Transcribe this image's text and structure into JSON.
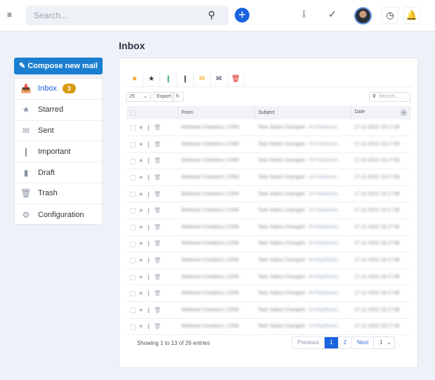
{
  "topbar": {
    "search_placeholder": "Search...",
    "icons": [
      "menu-icon",
      "search-icon",
      "plus-icon",
      "share-icon",
      "check-icon",
      "avatar",
      "clock-icon",
      "bell-icon"
    ]
  },
  "page_title": "Inbox",
  "sidebar": {
    "compose_label": "Compose new mail",
    "items": [
      {
        "label": "Inbox",
        "icon": "inbox-icon",
        "badge": "3",
        "active": true
      },
      {
        "label": "Starred",
        "icon": "star-icon"
      },
      {
        "label": "Sent",
        "icon": "envelope-icon"
      },
      {
        "label": "Important",
        "icon": "bookmark-icon"
      },
      {
        "label": "Draft",
        "icon": "draft-icon"
      },
      {
        "label": "Trash",
        "icon": "trash-icon"
      },
      {
        "label": "Configuration",
        "icon": "gears-icon"
      }
    ]
  },
  "toolbar": {
    "filters": [
      {
        "icon": "star-icon",
        "color": "#f59e0b"
      },
      {
        "icon": "star-icon",
        "color": "#2b3546"
      },
      {
        "icon": "bookmark-icon",
        "color": "#22a04b"
      },
      {
        "icon": "bookmark-icon",
        "color": "#2b3546"
      },
      {
        "icon": "envelope-icon",
        "color": "#f59e0b"
      },
      {
        "icon": "envelope-icon",
        "color": "#2b3546"
      },
      {
        "icon": "trash-icon",
        "color": "#e11d1d"
      }
    ],
    "page_length": "25",
    "export_label": "Export",
    "search_placeholder": "Search..."
  },
  "table": {
    "headers": [
      "From",
      "Subject",
      "Date"
    ],
    "rows": [
      {
        "from": "Webwise Creations | CRM",
        "subject": "Task Status Changed",
        "preview": "- Hi PaulGrant...",
        "date": "17-11-2022 18:17:08"
      },
      {
        "from": "Webwise Creations | CRM",
        "subject": "Task Status Changed",
        "preview": "- Hi PaulGrant...",
        "date": "17-11-2022 18:17:08"
      },
      {
        "from": "Webwise Creations | CRM",
        "subject": "Task Status Changed",
        "preview": "- Hi PaulGrant...",
        "date": "17-11-2022 18:17:08"
      },
      {
        "from": "Webwise Creations | CRM",
        "subject": "Task Status Changed",
        "preview": "- Hi PaulGrant...",
        "date": "17-11-2022 18:17:08"
      },
      {
        "from": "Webwise Creations | CRM",
        "subject": "Task Status Changed",
        "preview": "- Hi PaulGrant...",
        "date": "17-11-2022 18:17:08"
      },
      {
        "from": "Webwise Creations | CRM",
        "subject": "Task Status Changed",
        "preview": "- Hi PaulGrant...",
        "date": "17-11-2022 18:17:08"
      },
      {
        "from": "Webwise Creations | CRM",
        "subject": "Task Status Changed",
        "preview": "- Hi PaulGrant...",
        "date": "17-11-2022 18:17:08"
      },
      {
        "from": "Webwise Creations | CRM",
        "subject": "Task Status Changed",
        "preview": "- Hi PaulGrant...",
        "date": "17-11-2022 18:17:08"
      },
      {
        "from": "Webwise Creations | CRM",
        "subject": "Task Status Changed",
        "preview": "- Hi PaulGrant...",
        "date": "17-11-2022 18:17:08"
      },
      {
        "from": "Webwise Creations | CRM",
        "subject": "Task Status Changed",
        "preview": "- Hi PaulGrant...",
        "date": "17-11-2022 18:17:08"
      },
      {
        "from": "Webwise Creations | CRM",
        "subject": "Task Status Changed",
        "preview": "- Hi PaulGrant...",
        "date": "17-11-2022 18:17:08"
      },
      {
        "from": "Webwise Creations | CRM",
        "subject": "Task Status Changed",
        "preview": "- Hi PaulGrant...",
        "date": "17-11-2022 18:17:08"
      },
      {
        "from": "Webwise Creations | CRM",
        "subject": "Task Status Changed",
        "preview": "- Hi PaulGrant...",
        "date": "17-11-2022 18:17:08"
      }
    ]
  },
  "footer": {
    "info": "Showing 1 to 13 of 26 entries",
    "previous": "Previous",
    "pages": [
      "1",
      "2"
    ],
    "current_page": "1",
    "next": "Next",
    "page_select": "1"
  }
}
